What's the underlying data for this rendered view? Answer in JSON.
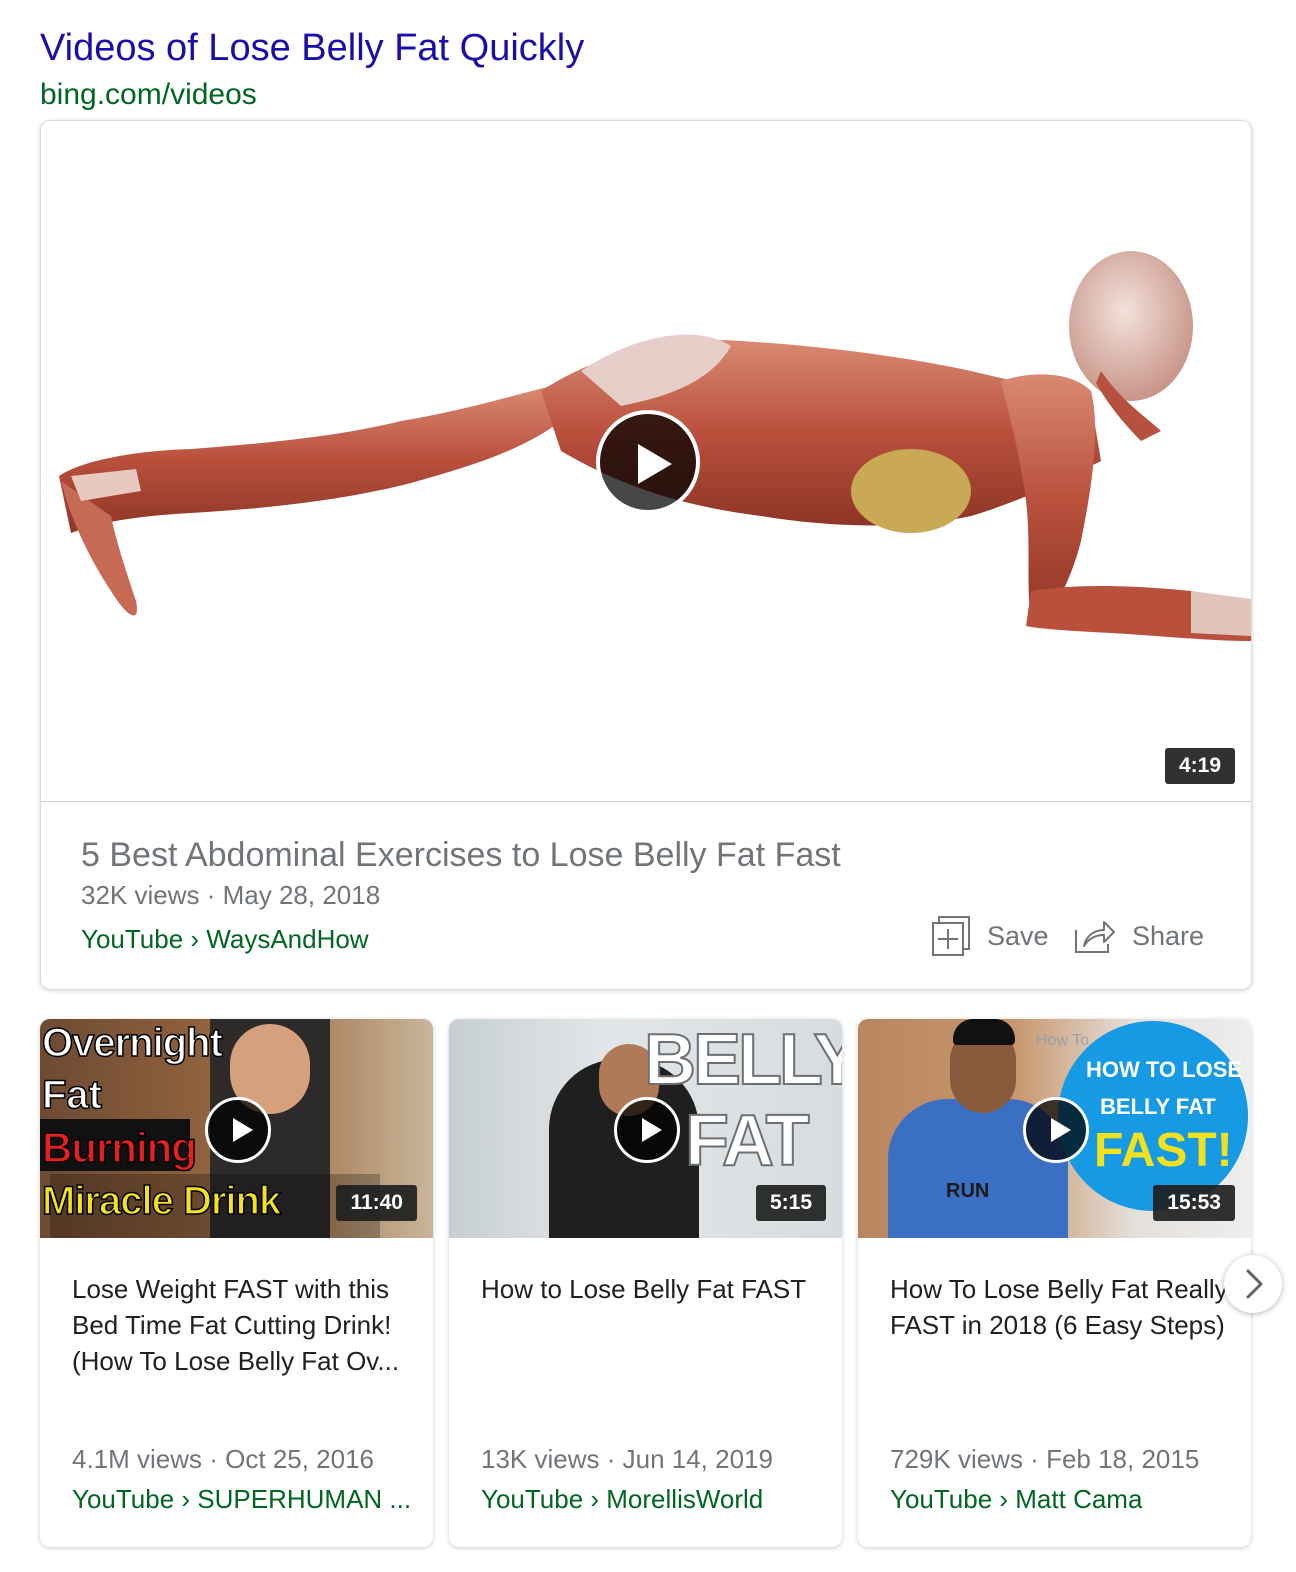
{
  "header": {
    "title": "Videos of Lose Belly Fat Quickly",
    "url": "bing.com/videos"
  },
  "featured": {
    "duration": "4:19",
    "title": "5 Best Abdominal Exercises to Lose Belly Fat Fast",
    "meta": "32K views · May 28, 2018",
    "source": "YouTube › WaysAndHow",
    "save_label": "Save",
    "share_label": "Share"
  },
  "cards": [
    {
      "duration": "11:40",
      "title": "Lose Weight FAST with this Bed Time Fat Cutting Drink! (How To Lose Belly Fat Ov...",
      "meta": "4.1M views · Oct 25, 2016",
      "source": "YouTube › SUPERHUMAN ...",
      "thumb_text": [
        "Overnight",
        "Fat",
        "Burning",
        "Miracle Drink"
      ]
    },
    {
      "duration": "5:15",
      "title": "How to Lose Belly Fat FAST",
      "meta": "13K views · Jun 14, 2019",
      "source": "YouTube › MorellisWorld",
      "thumb_text": [
        "BELLY",
        "FAT"
      ]
    },
    {
      "duration": "15:53",
      "title": "How To Lose Belly Fat Really FAST in 2018 (6 Easy Steps)",
      "meta": "729K views · Feb 18, 2015",
      "source": "YouTube › Matt Cama",
      "thumb_text": [
        "HOW TO LOSE",
        "BELLY FAT",
        "FAST!",
        "How To",
        "RUN"
      ]
    }
  ],
  "icons": {
    "play": "play-icon",
    "save": "save-icon",
    "share": "share-icon",
    "next": "chevron-right-icon"
  },
  "colors": {
    "link": "#1a0dab",
    "url_green": "#006621",
    "meta_gray": "#70757a"
  }
}
